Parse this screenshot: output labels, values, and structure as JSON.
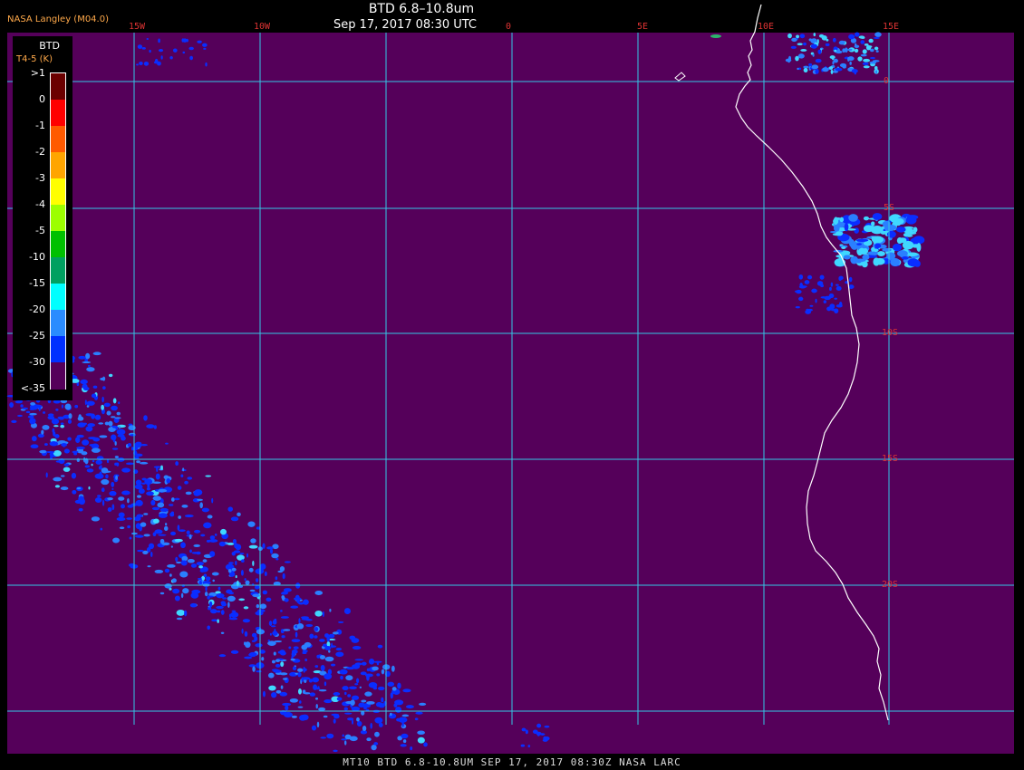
{
  "header": {
    "title": "BTD 6.8–10.8um",
    "subtitle": "Sep 17, 2017 08:30 UTC",
    "provider": "NASA Langley (M04.0)"
  },
  "footer": {
    "caption": "MT10  BTD 6.8-10.8UM   SEP 17, 2017 08:30Z   NASA LARC"
  },
  "colors": {
    "background": "#55005a",
    "grid": "#33c7e6",
    "coastline": "#ffffff",
    "label": "#d33333",
    "cloud_dark": "#0a2dff",
    "cloud_mid": "#2a7fff",
    "cloud_light": "#3fd7ff"
  },
  "longitude_labels": [
    "15W",
    "10W",
    "0",
    "5E",
    "10E",
    "15E"
  ],
  "latitude_labels": [
    "0",
    "5S",
    "10S",
    "15S",
    "20S"
  ],
  "legend": {
    "title": "BTD",
    "unit": "T4-5 (K)",
    "ticks": [
      ">1",
      "0",
      "-1",
      "-2",
      "-3",
      "-4",
      "-5",
      "-10",
      "-15",
      "-20",
      "-25",
      "-30",
      "<-35"
    ],
    "colors": [
      "#6b0000",
      "#ff0000",
      "#ff5a00",
      "#ffa500",
      "#ffff00",
      "#9cff00",
      "#00c000",
      "#00a060",
      "#00ffff",
      "#2a8cff",
      "#0030ff",
      "#55005a"
    ]
  }
}
